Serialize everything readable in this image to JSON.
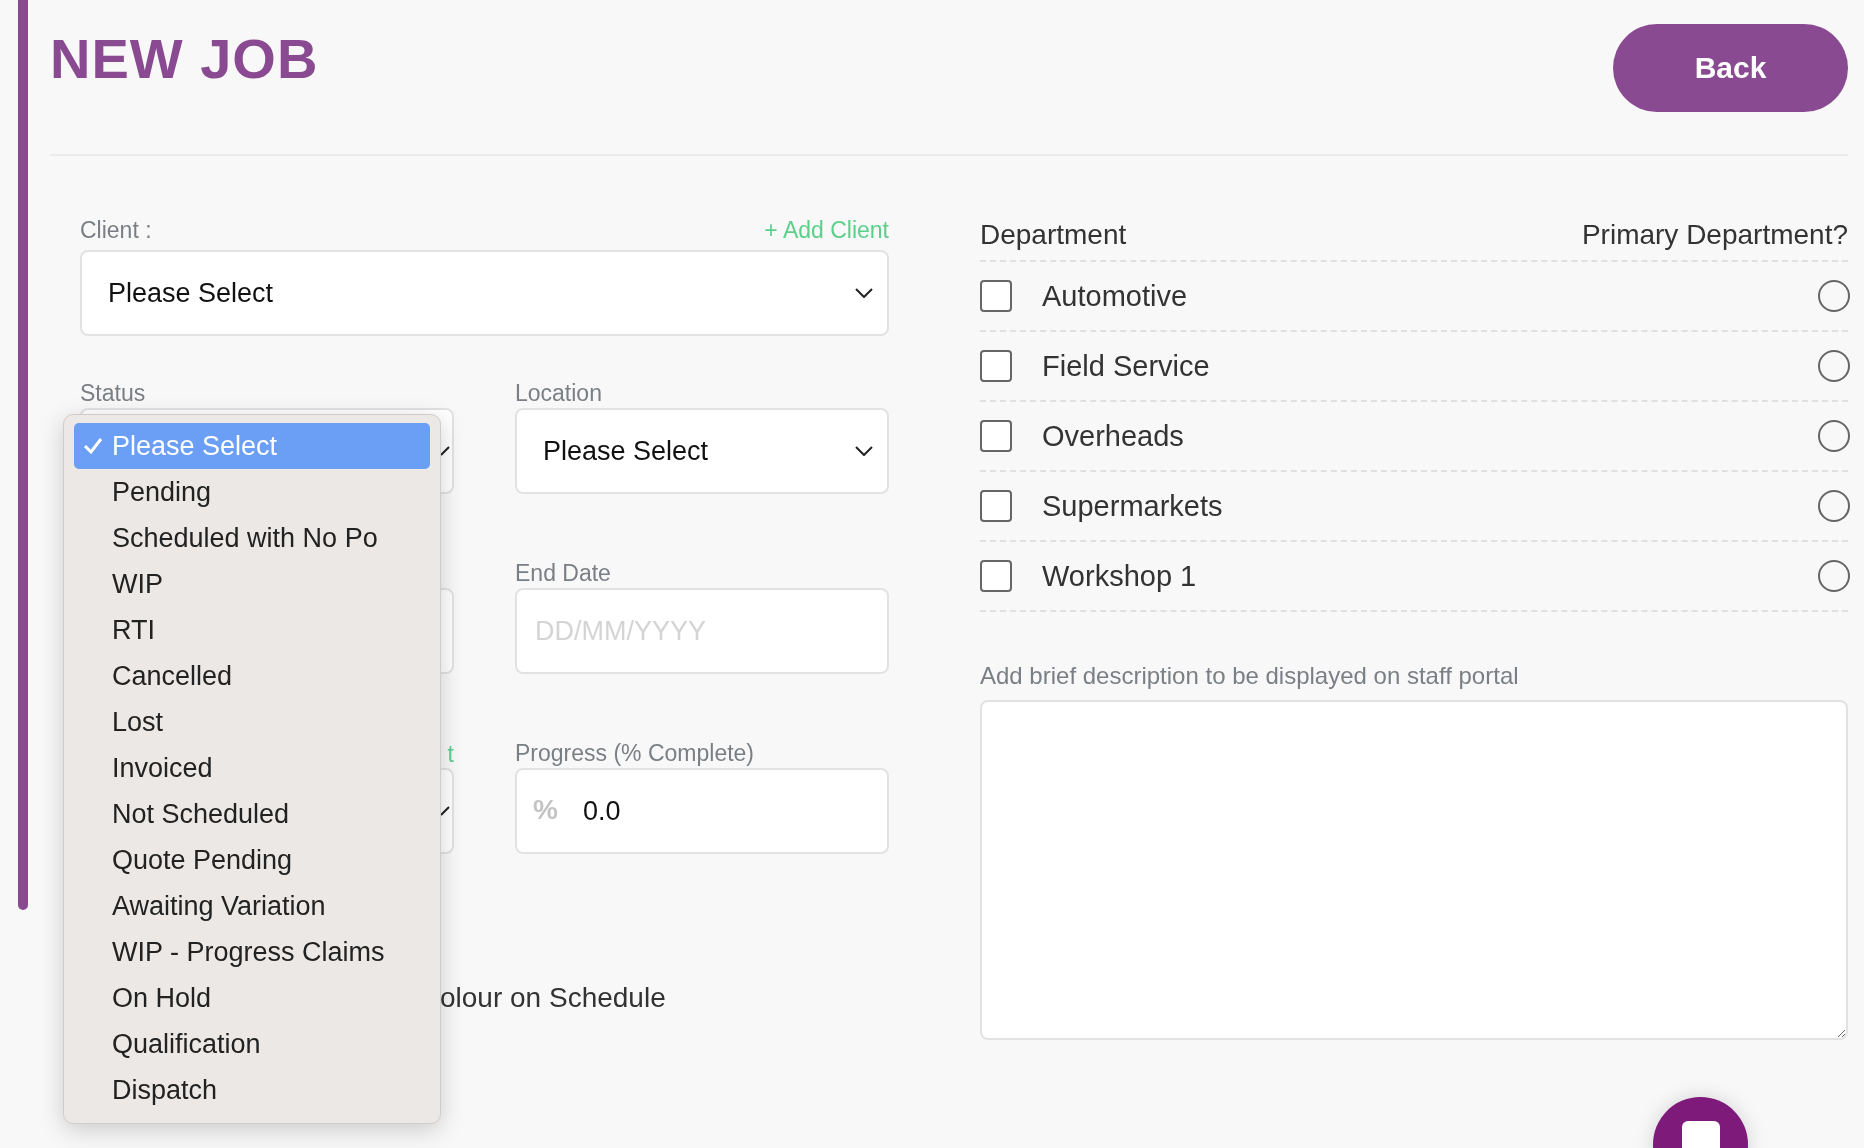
{
  "page": {
    "title": "NEW JOB",
    "back_button": "Back"
  },
  "client": {
    "label": "Client :",
    "add_link": "+ Add Client",
    "value": "Please Select"
  },
  "status": {
    "label": "Status"
  },
  "location": {
    "label": "Location",
    "value": "Please Select"
  },
  "end_date": {
    "label": "End Date",
    "placeholder": "DD/MM/YYYY"
  },
  "covered_link": "t",
  "progress": {
    "label": "Progress (% Complete)",
    "prefix": "%",
    "value": "0.0"
  },
  "schedule_colour_label": "olour on Schedule",
  "status_menu": [
    {
      "label": "Please Select",
      "selected": true
    },
    {
      "label": "Pending",
      "selected": false
    },
    {
      "label": "Scheduled with No Po",
      "selected": false
    },
    {
      "label": "WIP",
      "selected": false
    },
    {
      "label": "RTI",
      "selected": false
    },
    {
      "label": "Cancelled",
      "selected": false
    },
    {
      "label": "Lost",
      "selected": false
    },
    {
      "label": "Invoiced",
      "selected": false
    },
    {
      "label": "Not Scheduled",
      "selected": false
    },
    {
      "label": "Quote Pending",
      "selected": false
    },
    {
      "label": "Awaiting Variation",
      "selected": false
    },
    {
      "label": "WIP - Progress Claims",
      "selected": false
    },
    {
      "label": "On Hold",
      "selected": false
    },
    {
      "label": "Qualification",
      "selected": false
    },
    {
      "label": "Dispatch",
      "selected": false
    }
  ],
  "departments": {
    "header": "Department",
    "primary_header": "Primary Department?",
    "items": [
      {
        "name": "Automotive",
        "checked": false,
        "primary": false
      },
      {
        "name": "Field Service",
        "checked": false,
        "primary": false
      },
      {
        "name": "Overheads",
        "checked": false,
        "primary": false
      },
      {
        "name": "Supermarkets",
        "checked": false,
        "primary": false
      },
      {
        "name": "Workshop 1",
        "checked": false,
        "primary": false
      }
    ]
  },
  "description": {
    "label": "Add brief description to be displayed on staff portal"
  }
}
